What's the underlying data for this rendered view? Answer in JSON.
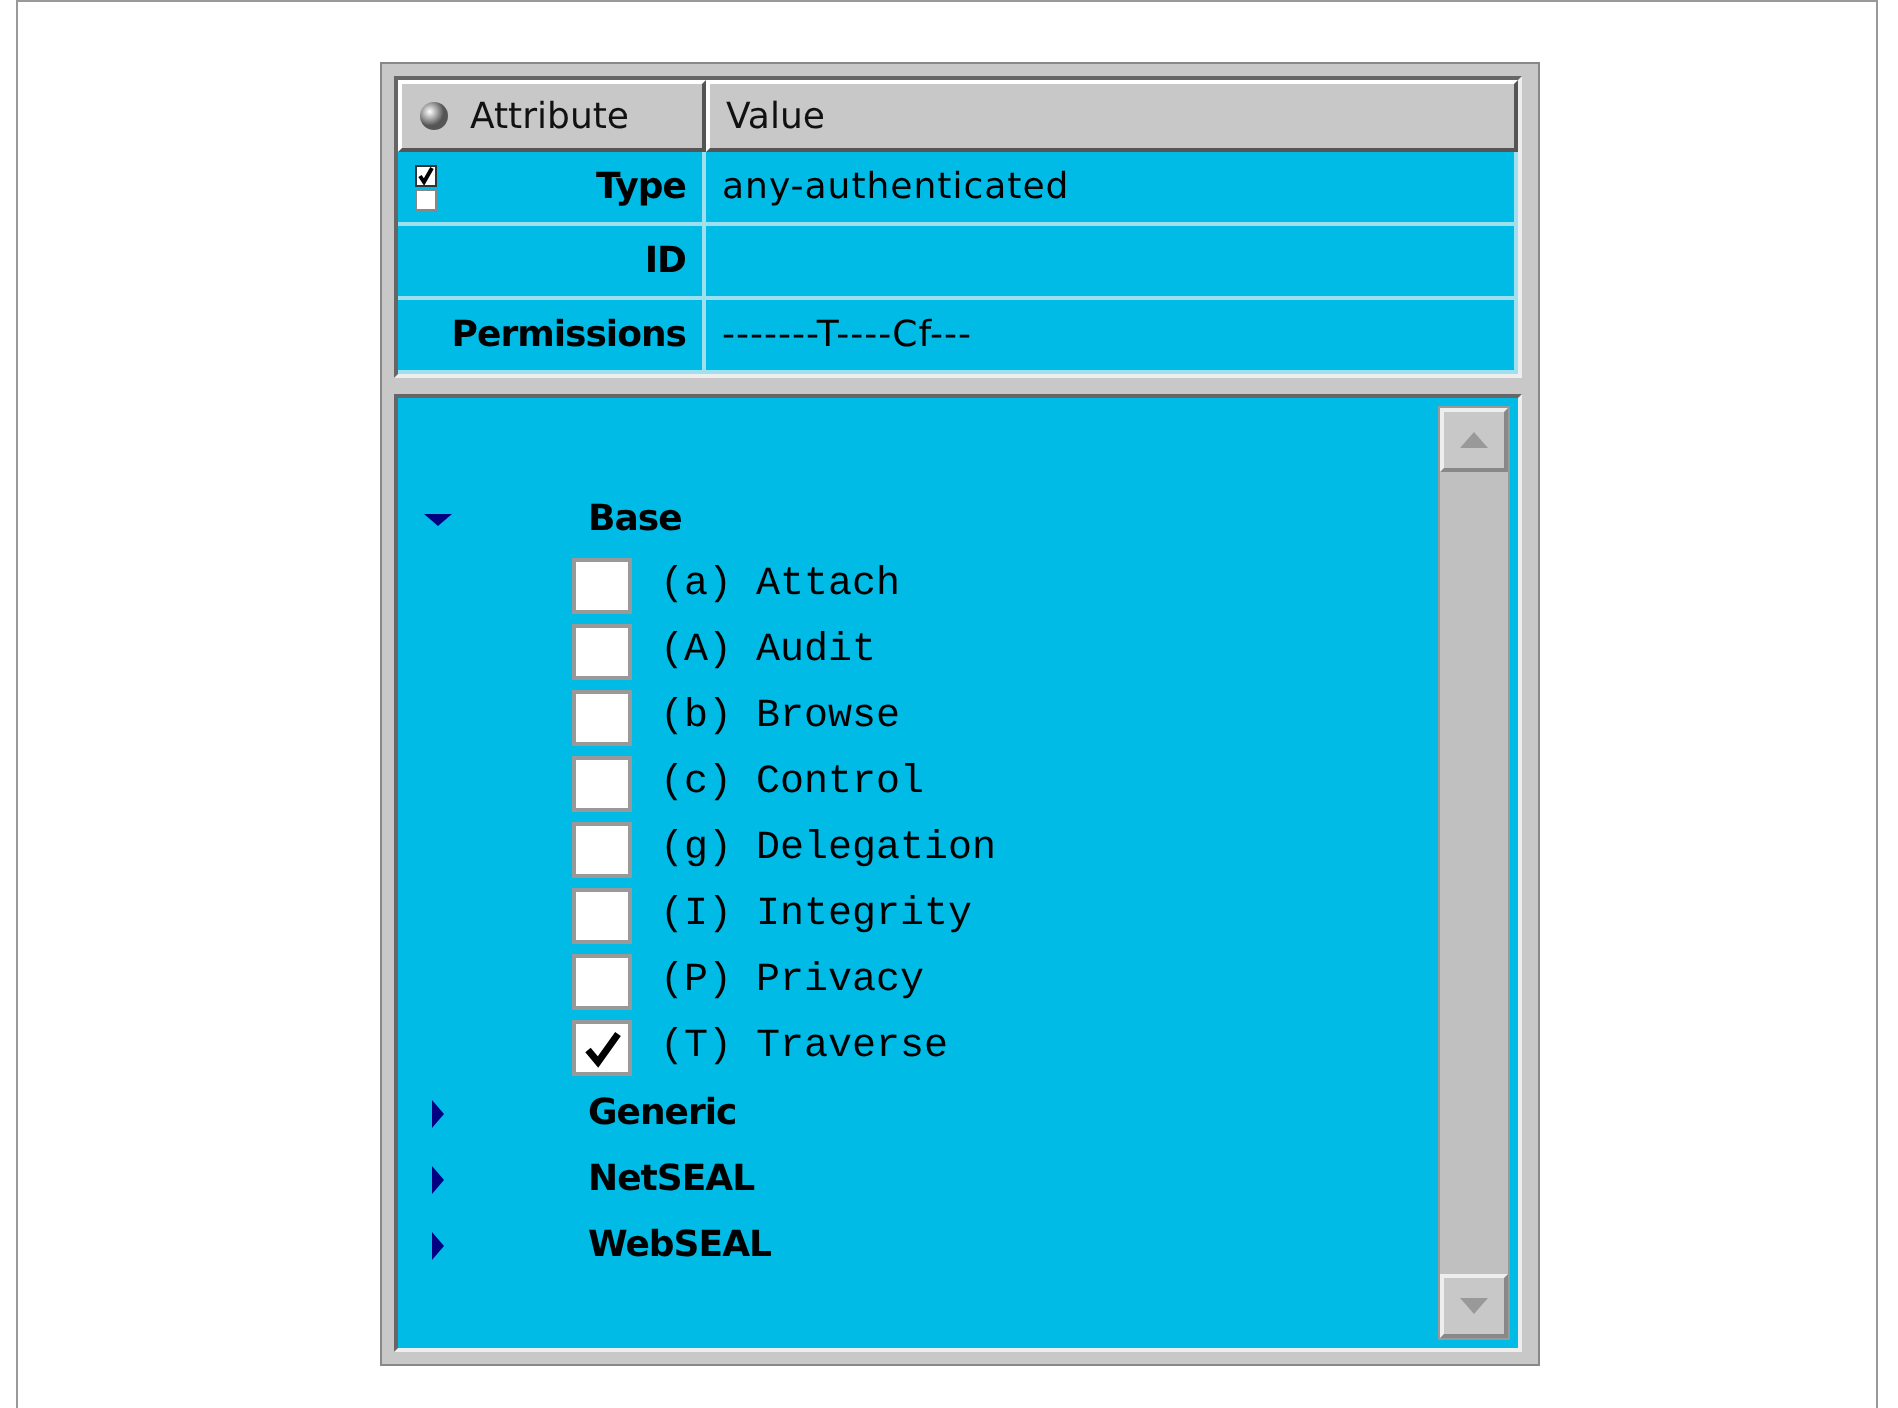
{
  "table": {
    "columns": [
      "Attribute",
      "Value"
    ],
    "rows": [
      {
        "attribute": "Type",
        "value": "any-authenticated",
        "marker": true
      },
      {
        "attribute": "ID",
        "value": ""
      },
      {
        "attribute": "Permissions",
        "value": "-------T----Cf---"
      }
    ]
  },
  "tree": [
    {
      "label": "Base",
      "expanded": true,
      "children": [
        {
          "label": "(a) Attach",
          "checked": false
        },
        {
          "label": "(A) Audit",
          "checked": false
        },
        {
          "label": "(b) Browse",
          "checked": false
        },
        {
          "label": "(c) Control",
          "checked": false
        },
        {
          "label": "(g) Delegation",
          "checked": false
        },
        {
          "label": "(I) Integrity",
          "checked": false
        },
        {
          "label": "(P) Privacy",
          "checked": false
        },
        {
          "label": "(T) Traverse",
          "checked": true
        }
      ]
    },
    {
      "label": "Generic",
      "expanded": false
    },
    {
      "label": "NetSEAL",
      "expanded": false
    },
    {
      "label": "WebSEAL",
      "expanded": false
    }
  ]
}
